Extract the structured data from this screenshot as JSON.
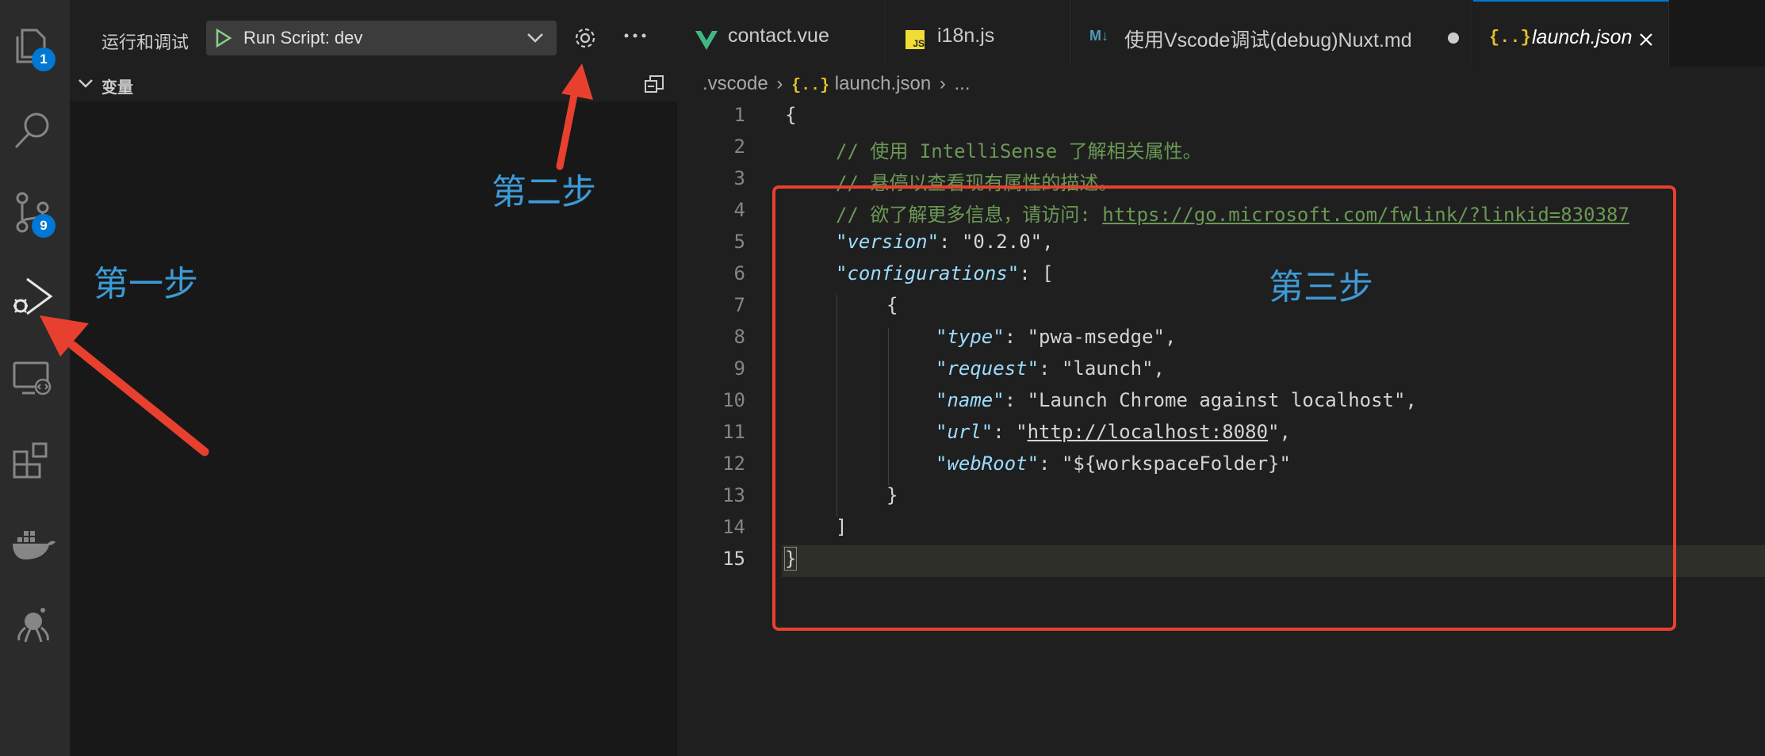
{
  "activity": {
    "explorer_badge": "1",
    "scm_badge": "9"
  },
  "sidebar": {
    "title": "运行和调试",
    "run_config": "Run Script: dev",
    "section_title": "变量"
  },
  "tabs": [
    {
      "label": "contact.vue",
      "icon": "vue-icon"
    },
    {
      "label": "i18n.js",
      "icon": "js-icon",
      "icon_text": "JS"
    },
    {
      "label": "使用Vscode调试(debug)Nuxt.md",
      "icon": "markdown-icon",
      "icon_text": "M↓"
    },
    {
      "label": "launch.json",
      "icon": "json-icon",
      "icon_text": "{..}"
    }
  ],
  "breadcrumb": {
    "folder": ".vscode",
    "file": "launch.json",
    "more": "...",
    "icon_text": "{..}"
  },
  "code": {
    "line_numbers": [
      "1",
      "2",
      "3",
      "4",
      "5",
      "6",
      "7",
      "8",
      "9",
      "10",
      "11",
      "12",
      "13",
      "14",
      "15"
    ],
    "l1": "{",
    "l2_comment": "// 使用 IntelliSense 了解相关属性。",
    "l3_comment": "// 悬停以查看现有属性的描述。",
    "l4_comment": "// 欲了解更多信息，请访问: ",
    "l4_link": "https://go.microsoft.com/fwlink/?linkid=830387",
    "version_key": "\"version\"",
    "version_val": "\"0.2.0\"",
    "configurations_key": "\"configurations\"",
    "open_bracket": "[",
    "open_brace": "{",
    "type_key": "\"type\"",
    "type_val": "\"pwa-msedge\"",
    "request_key": "\"request\"",
    "request_val": "\"launch\"",
    "name_key": "\"name\"",
    "name_val": "\"Launch Chrome against localhost\"",
    "url_key": "\"url\"",
    "url_val_prefix": "\"",
    "url_val_link": "http://localhost:8080",
    "url_val_suffix": "\"",
    "webroot_key": "\"webRoot\"",
    "webroot_val": "\"${workspaceFolder}\"",
    "close_brace": "}",
    "close_bracket": "]",
    "l15": "}"
  },
  "annotations": {
    "step1": "第一步",
    "step2": "第二步",
    "step3": "第三步"
  },
  "colors": {
    "annotation_red": "#e8402f",
    "annotation_blue": "#3d9ad6",
    "badge_blue": "#0078d4"
  }
}
